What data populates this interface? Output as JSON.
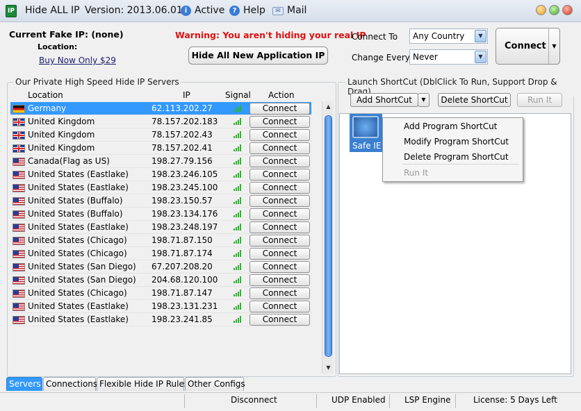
{
  "title_bar": {
    "app_name": "Hide ALL IP",
    "version": "Version: 2013.06.01",
    "active_label": "Active",
    "help_label": "Help",
    "mail_label": "Mail",
    "app_icon_text": "IP"
  },
  "top": {
    "current_fake_ip": "Current Fake IP: (none)",
    "location_label": "Location:",
    "buy_link": "Buy Now Only $29",
    "warning": "Warning: You aren't hiding your real IP",
    "hide_app_button": "Hide All New Application IP",
    "connect_to_label": "Connect To",
    "connect_to_value": "Any Country",
    "change_every_label": "Change Every",
    "change_every_value": "Never",
    "connect_button": "Connect"
  },
  "servers": {
    "group_title": "Our Private High Speed Hide IP Servers",
    "columns": [
      "Location",
      "IP",
      "Signal",
      "Action"
    ],
    "action_label": "Connect",
    "rows": [
      {
        "flag": "de",
        "location": "Germany",
        "ip": "62.113.202.27",
        "selected": true
      },
      {
        "flag": "gb",
        "location": "United Kingdom",
        "ip": "78.157.202.183"
      },
      {
        "flag": "gb",
        "location": "United Kingdom",
        "ip": "78.157.202.43"
      },
      {
        "flag": "gb",
        "location": "United Kingdom",
        "ip": "78.157.202.41"
      },
      {
        "flag": "us",
        "location": "Canada(Flag as US)",
        "ip": "198.27.79.156"
      },
      {
        "flag": "us",
        "location": "United States (Eastlake)",
        "ip": "198.23.246.105"
      },
      {
        "flag": "us",
        "location": "United States (Eastlake)",
        "ip": "198.23.245.100"
      },
      {
        "flag": "us",
        "location": "United States (Buffalo)",
        "ip": "198.23.150.57"
      },
      {
        "flag": "us",
        "location": "United States (Buffalo)",
        "ip": "198.23.134.176"
      },
      {
        "flag": "us",
        "location": "United States (Eastlake)",
        "ip": "198.23.248.197"
      },
      {
        "flag": "us",
        "location": "United States (Chicago)",
        "ip": "198.71.87.150"
      },
      {
        "flag": "us",
        "location": "United States (Chicago)",
        "ip": "198.71.87.174"
      },
      {
        "flag": "us",
        "location": "United States (San Diego)",
        "ip": "67.207.208.20"
      },
      {
        "flag": "us",
        "location": "United States (San Diego)",
        "ip": "204.68.120.100"
      },
      {
        "flag": "us",
        "location": "United States (Chicago)",
        "ip": "198.71.87.147"
      },
      {
        "flag": "us",
        "location": "United States (Eastlake)",
        "ip": "198.23.131.231"
      },
      {
        "flag": "us",
        "location": "United States (Eastlake)",
        "ip": "198.23.241.85"
      }
    ]
  },
  "shortcuts": {
    "group_title": "Launch ShortCut (DblClick To Run, Support Drop & Drag)",
    "add_button": "Add ShortCut",
    "delete_button": "Delete ShortCut",
    "run_button": "Run It",
    "icon_label": "Safe IE",
    "context_menu": [
      "Add Program ShortCut",
      "Modify Program ShortCut",
      "Delete Program ShortCut",
      "Run It"
    ]
  },
  "tabs": [
    "Servers",
    "Connections",
    "Flexible Hide IP Rules",
    "Other Configs"
  ],
  "status": {
    "connection": "Disconnect",
    "udp": "UDP Enabled",
    "lsp": "LSP Engine",
    "license": "License: 5 Days Left"
  },
  "colors": {
    "selection": "#3399ff",
    "warning": "#e01010",
    "signal": "#2db52d"
  }
}
